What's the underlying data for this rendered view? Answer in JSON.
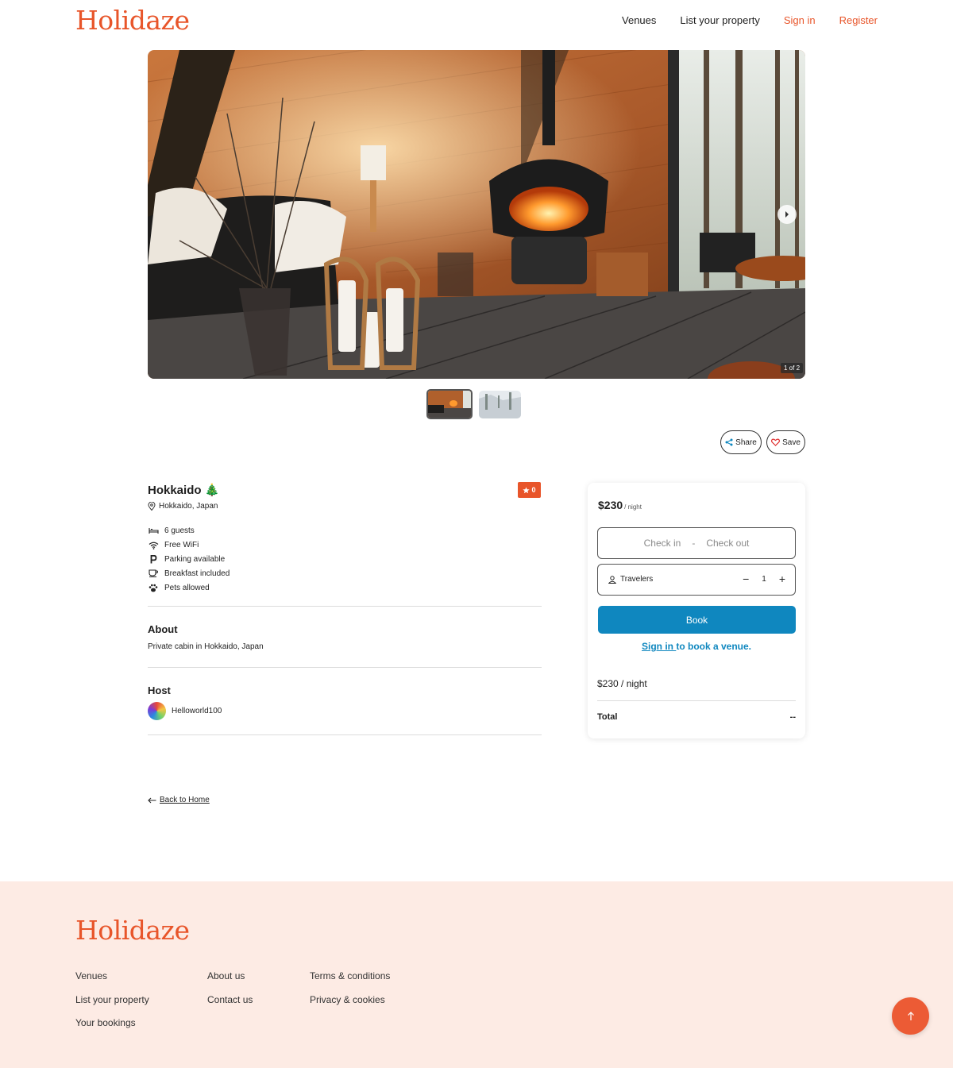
{
  "header": {
    "logo": "Holidaze",
    "nav": {
      "venues": "Venues",
      "list_property": "List your property",
      "sign_in": "Sign in",
      "register": "Register"
    }
  },
  "gallery": {
    "counter": "1 of 2",
    "share_label": "Share",
    "save_label": "Save"
  },
  "venue": {
    "title": "Hokkaido 🎄",
    "rating": "0",
    "location": "Hokkaido, Japan",
    "amenities": [
      {
        "icon": "bed-icon",
        "label": "6 guests"
      },
      {
        "icon": "wifi-icon",
        "label": "Free WiFi"
      },
      {
        "icon": "parking-icon",
        "label": "Parking available"
      },
      {
        "icon": "coffee-icon",
        "label": "Breakfast included"
      },
      {
        "icon": "paw-icon",
        "label": "Pets allowed"
      }
    ],
    "about_heading": "About",
    "about_text": "Private cabin in Hokkaido, Japan",
    "host_heading": "Host",
    "host_name": "Helloworld100"
  },
  "booking": {
    "price": "$230",
    "price_unit": "/ night",
    "check_in": "Check in",
    "separator": "-",
    "check_out": "Check out",
    "travelers_label": "Travelers",
    "travelers_count": "1",
    "book_label": "Book",
    "signin_link": "Sign in ",
    "signin_suffix": "to book a venue.",
    "per_night": "$230 / night",
    "total_label": "Total",
    "total_value": "--"
  },
  "back_link": "Back to Home",
  "footer": {
    "logo": "Holidaze",
    "col1": [
      "Venues",
      "List your property",
      "Your bookings"
    ],
    "col2": [
      "About us",
      "Contact us"
    ],
    "col3": [
      "Terms & conditions",
      "Privacy & cookies"
    ]
  },
  "colors": {
    "brand": "#e8552a",
    "primary": "#0f87bf",
    "footer_bg": "#fdebe4"
  }
}
